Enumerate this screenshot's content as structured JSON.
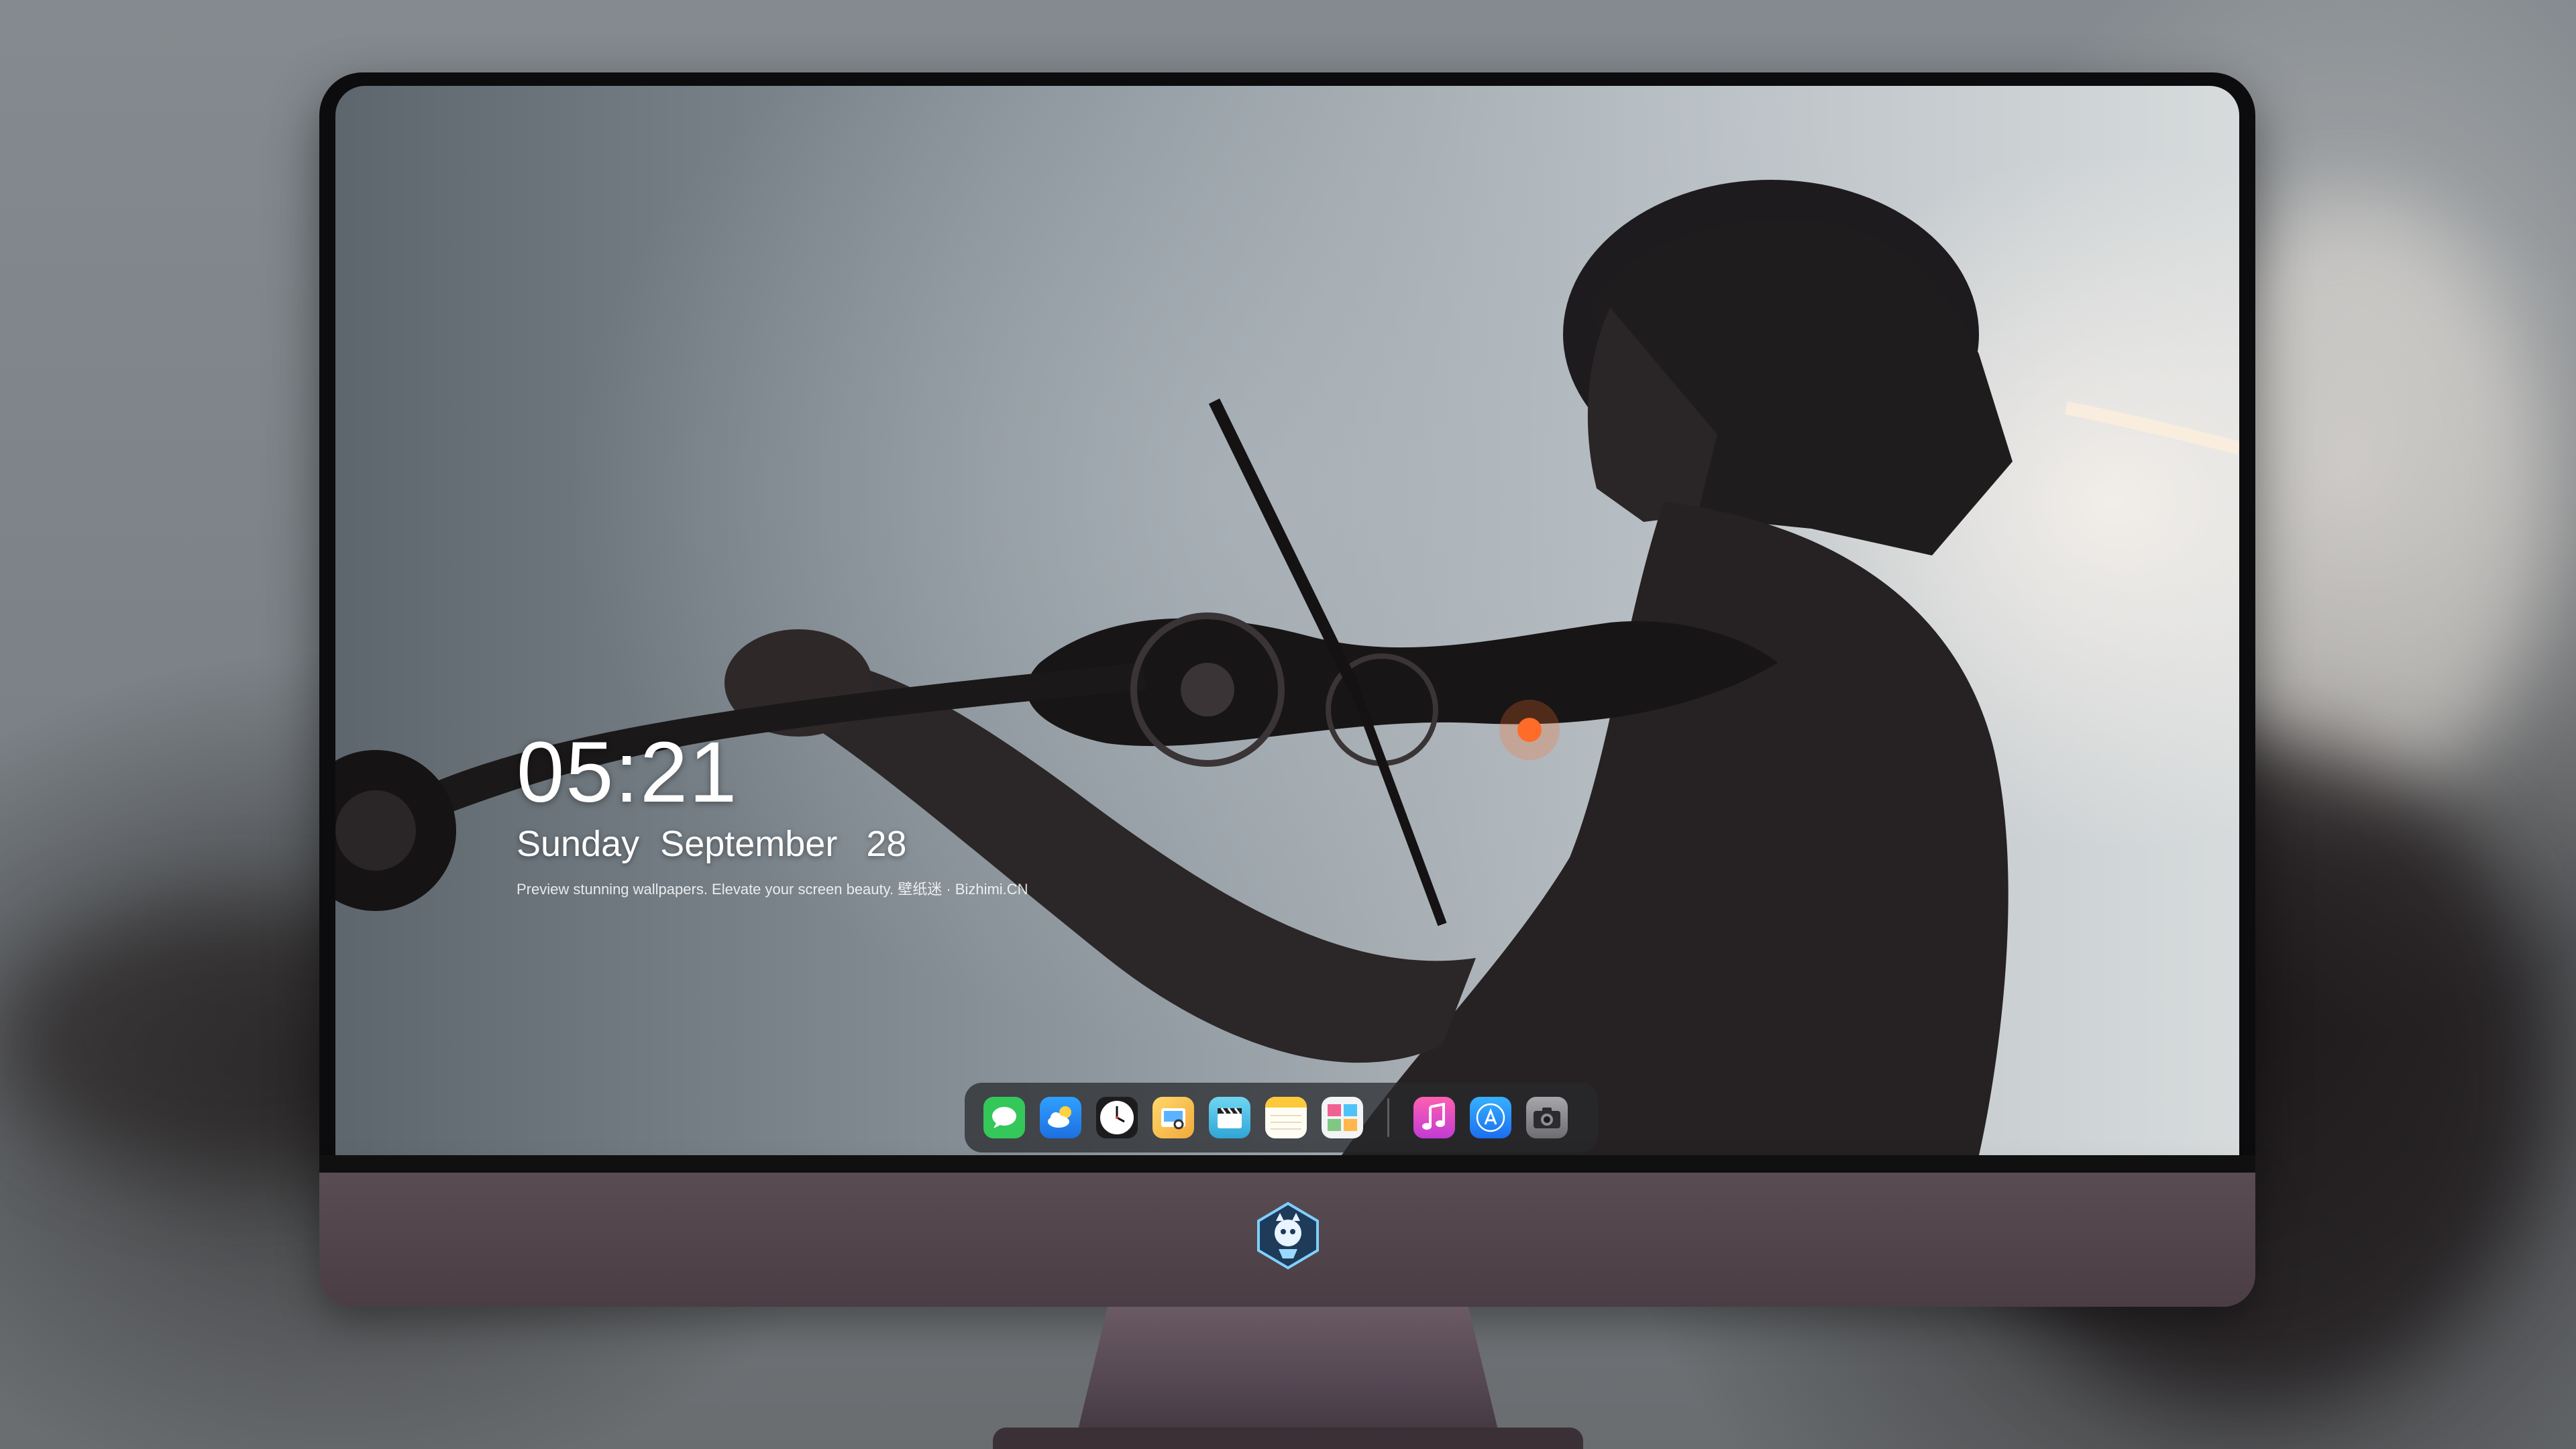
{
  "lockscreen": {
    "time": "05:21",
    "weekday": "Sunday",
    "month": "September",
    "day": "28",
    "tagline": "Preview stunning wallpapers. Elevate your screen beauty. 壁纸迷 · Bizhimi.CN"
  },
  "dock": {
    "apps": [
      {
        "name": "messages",
        "icon": "chat-bubble-icon",
        "color": "#34c759"
      },
      {
        "name": "weather",
        "icon": "cloud-sun-icon",
        "color": "#1e90ff"
      },
      {
        "name": "clock",
        "icon": "clock-icon",
        "color": "#ffffff"
      },
      {
        "name": "preview",
        "icon": "photos-viewer-icon",
        "color": "#f5c542"
      },
      {
        "name": "clips",
        "icon": "clapperboard-icon",
        "color": "#4cc3e6"
      },
      {
        "name": "notes",
        "icon": "notes-icon",
        "color": "#fcd34d"
      },
      {
        "name": "photo-booth",
        "icon": "photo-grid-icon",
        "color": "#e2e8f0"
      },
      {
        "name": "music",
        "icon": "music-note-icon",
        "color": "#f84b9d"
      },
      {
        "name": "app-store",
        "icon": "app-store-icon",
        "color": "#1a8cff"
      },
      {
        "name": "camera",
        "icon": "camera-icon",
        "color": "#8e8e93"
      }
    ]
  }
}
